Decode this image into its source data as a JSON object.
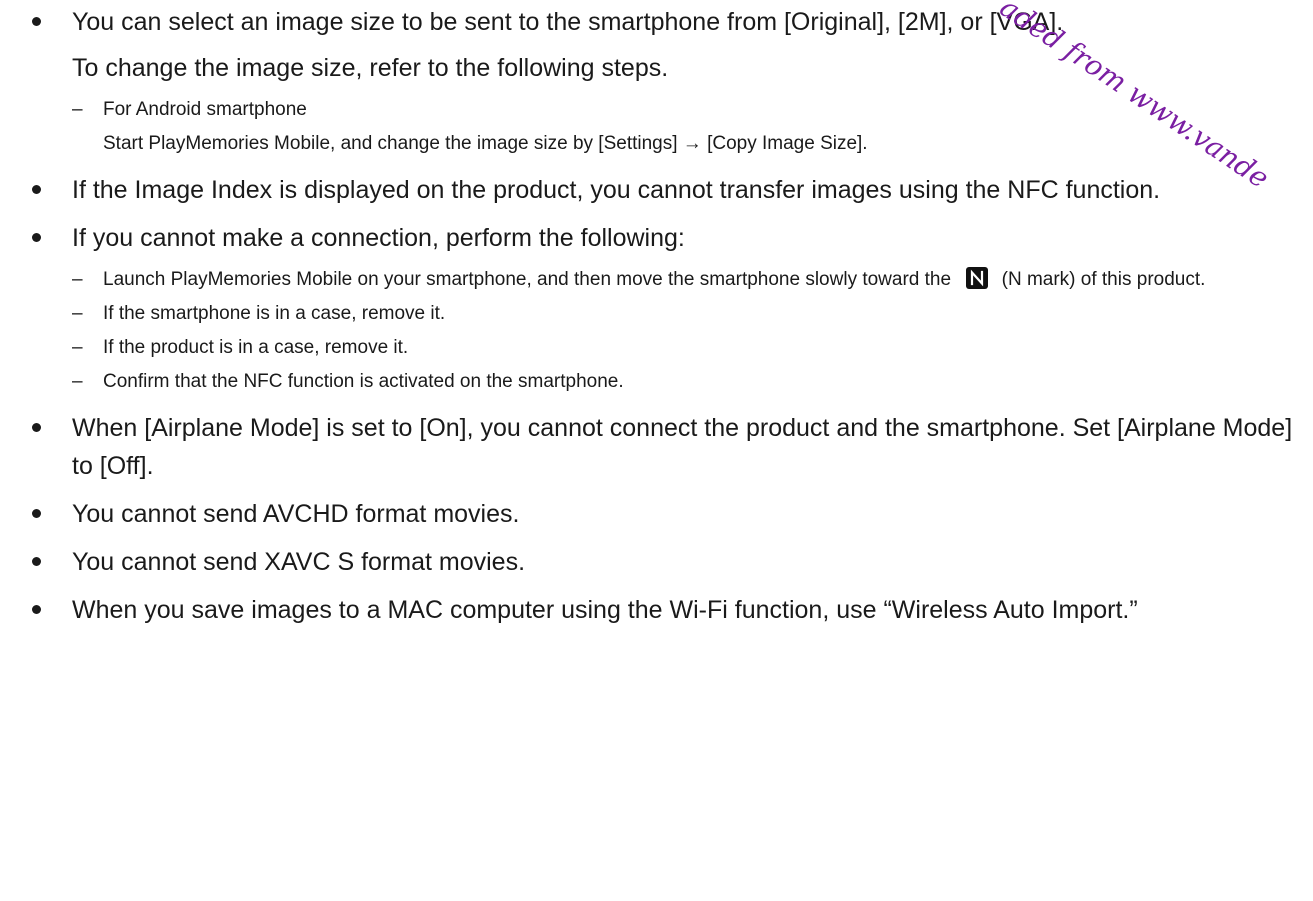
{
  "items": [
    {
      "paragraphs": [
        "You can select an image size to be sent to the smartphone from [Original], [2M], or [VGA].",
        "To change the image size, refer to the following steps."
      ],
      "subs": [
        {
          "lines": [
            "For Android smartphone",
            "Start PlayMemories Mobile, and change the image size by [Settings] → [Copy Image Size]."
          ]
        }
      ]
    },
    {
      "paragraphs": [
        "If the Image Index is displayed on the product, you cannot transfer images using the NFC function."
      ]
    },
    {
      "paragraphs": [
        "If you cannot make a connection, perform the following:"
      ],
      "subs": [
        {
          "before_icon": "Launch PlayMemories Mobile on your smartphone, and then move the smartphone slowly toward the",
          "after_icon": "(N mark) of this product."
        },
        {
          "text": "If the smartphone is in a case, remove it."
        },
        {
          "text": "If the product is in a case, remove it."
        },
        {
          "text": "Confirm that the NFC function is activated on the smartphone."
        }
      ]
    },
    {
      "paragraphs": [
        "When [Airplane Mode] is set to [On], you cannot connect the product and the smartphone. Set [Airplane Mode] to [Off]."
      ]
    },
    {
      "paragraphs": [
        "You cannot send AVCHD format movies."
      ]
    },
    {
      "paragraphs": [
        "You cannot send XAVC S format movies."
      ]
    },
    {
      "paragraphs": [
        "When you save images to a MAC computer using the Wi-Fi function, use “Wireless Auto Import.”"
      ]
    }
  ],
  "sub_marker": "–",
  "icons": {
    "nfc_mark": "nfc-n-mark-icon"
  },
  "watermark": {
    "text": "aded from www.vande",
    "color": "#7a1fa2"
  }
}
